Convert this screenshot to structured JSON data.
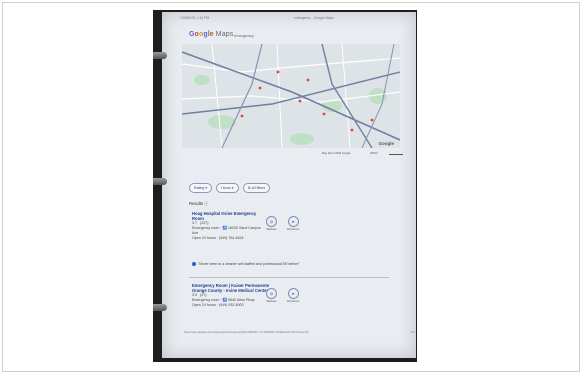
{
  "header": {
    "left": "7/26/2023, 1:11 PM",
    "right": "emergency - Google Maps"
  },
  "logo_letters": [
    {
      "ch": "G",
      "cls": "b"
    },
    {
      "ch": "o",
      "cls": "r"
    },
    {
      "ch": "o",
      "cls": "y"
    },
    {
      "ch": "g",
      "cls": "b"
    },
    {
      "ch": "l",
      "cls": "g"
    },
    {
      "ch": "e",
      "cls": "r"
    }
  ],
  "logo_suffix": " Maps",
  "search_query": "emergency",
  "map": {
    "watermark": "Google",
    "footer": "Map data ©2023 Google",
    "scale_label": "2000 ft"
  },
  "filters": [
    {
      "label": "Rating ▾"
    },
    {
      "label": "Hours ▾"
    },
    {
      "label": "⚙ All filters"
    }
  ],
  "results_title": "Results ⓘ",
  "listings": [
    {
      "name": "Hoag Hospital Irvine Emergency Room",
      "rating": "3.7",
      "count": "(227)",
      "detail": "Emergency room · ♿ 16200 Sand Canyon Ave",
      "hours": "Open 24 hours · (949) 764-4624",
      "website": "Website",
      "directions": "Directions"
    },
    {
      "name": "Emergency Room | Kaiser Permanente Orange County - Irvine Medical Center",
      "rating": "3.5",
      "count": "(27)",
      "detail": "Emergency room · ♿ 6640 Alton Pkwy",
      "hours": "Open 24 hours · (949) 932-5000",
      "website": "Website",
      "directions": "Directions"
    }
  ],
  "review_quote": "\"Never been to a cleaner well staffed and professional ER before\"",
  "footer": {
    "url": "https://www.google.com/maps/search/emergency/@33.6681232,-117.8262926,13z/data=!3m1!4b1?entry=ttu",
    "page": "1/4"
  },
  "colors": {
    "map_bg": "#dde3e7",
    "park": "#bfe0c5",
    "water": "#a9c9e8",
    "road_major": "#6f7fa3",
    "road_minor": "#ffffff"
  }
}
